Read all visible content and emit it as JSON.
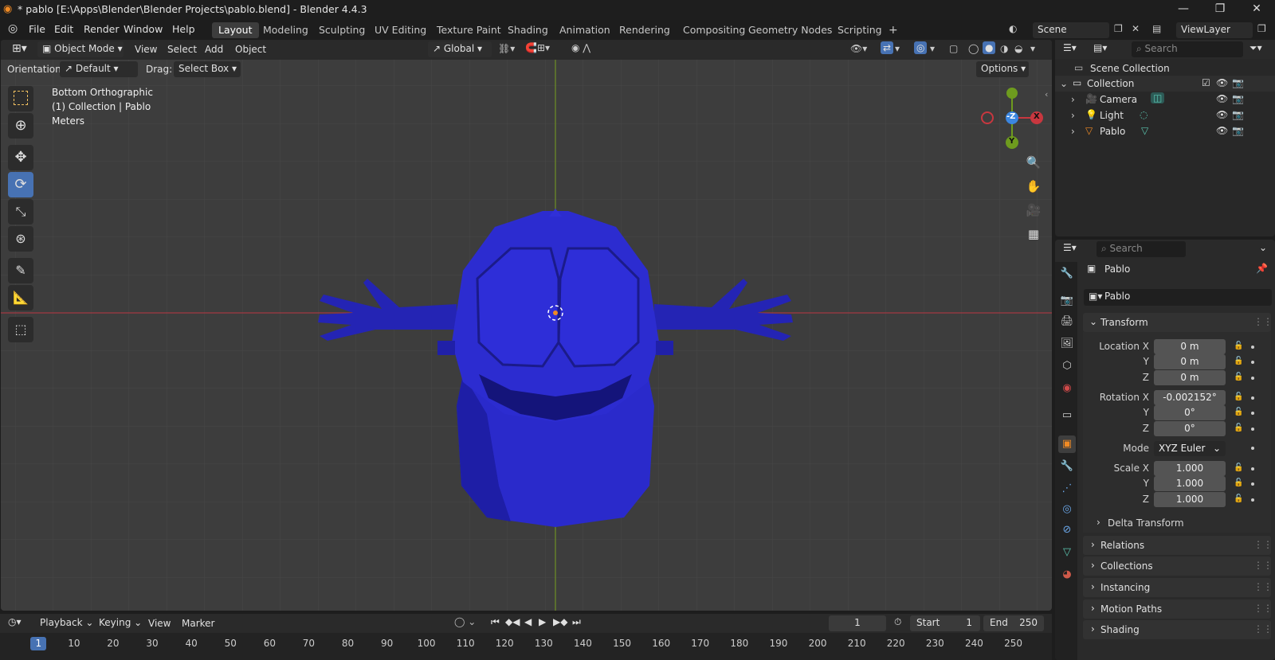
{
  "title": "* pablo [E:\\Apps\\Blender\\Blender Projects\\pablo.blend] - Blender 4.4.3",
  "menus": [
    "File",
    "Edit",
    "Render",
    "Window",
    "Help"
  ],
  "workspaces": [
    "Layout",
    "Modeling",
    "Sculpting",
    "UV Editing",
    "Texture Paint",
    "Shading",
    "Animation",
    "Rendering",
    "Compositing",
    "Geometry Nodes",
    "Scripting"
  ],
  "active_workspace": "Layout",
  "scene": "Scene",
  "view_layer": "ViewLayer",
  "viewport": {
    "mode": "Object Mode",
    "menus": [
      "View",
      "Select",
      "Add",
      "Object"
    ],
    "transform_orientation": "Global",
    "orientation_label": "Orientation:",
    "orientation_value": "Default",
    "drag_label": "Drag:",
    "drag_value": "Select Box",
    "options": "Options",
    "overlay_line1": "Bottom Orthographic",
    "overlay_line2": "(1) Collection | Pablo",
    "overlay_line3": "Meters",
    "gizmo": {
      "z": "-Z",
      "x": "X",
      "y": "Y"
    }
  },
  "outliner": {
    "search_placeholder": "Search",
    "scene_collection": "Scene Collection",
    "collection": "Collection",
    "items": [
      "Camera",
      "Light",
      "Pablo"
    ]
  },
  "properties": {
    "search_placeholder": "Search",
    "object_name": "Pablo",
    "datablock": "Pablo",
    "transform": "Transform",
    "location_label": "Location X",
    "location": [
      "0 m",
      "0 m",
      "0 m"
    ],
    "rotation_label": "Rotation X",
    "rotation": [
      "-0.002152°",
      "0°",
      "0°"
    ],
    "mode_label": "Mode",
    "mode_value": "XYZ Euler",
    "scale_label": "Scale X",
    "scale": [
      "1.000",
      "1.000",
      "1.000"
    ],
    "axis_y": "Y",
    "axis_z": "Z",
    "delta": "Delta Transform",
    "panels": [
      "Relations",
      "Collections",
      "Instancing",
      "Motion Paths",
      "Shading"
    ]
  },
  "timeline": {
    "menus": [
      "Playback",
      "Keying",
      "View",
      "Marker"
    ],
    "current_frame": "1",
    "start_label": "Start",
    "start": "1",
    "end_label": "End",
    "end": "250",
    "ticks": [
      "1",
      "10",
      "20",
      "30",
      "40",
      "50",
      "60",
      "70",
      "80",
      "90",
      "100",
      "110",
      "120",
      "130",
      "140",
      "150",
      "160",
      "170",
      "180",
      "190",
      "200",
      "210",
      "220",
      "230",
      "240",
      "250"
    ]
  },
  "colors": {
    "mesh": "#2828c8",
    "accent": "#4772b3",
    "x_axis": "#c8373f",
    "y_axis": "#6e9b1e",
    "z_axis": "#3b86e0"
  }
}
